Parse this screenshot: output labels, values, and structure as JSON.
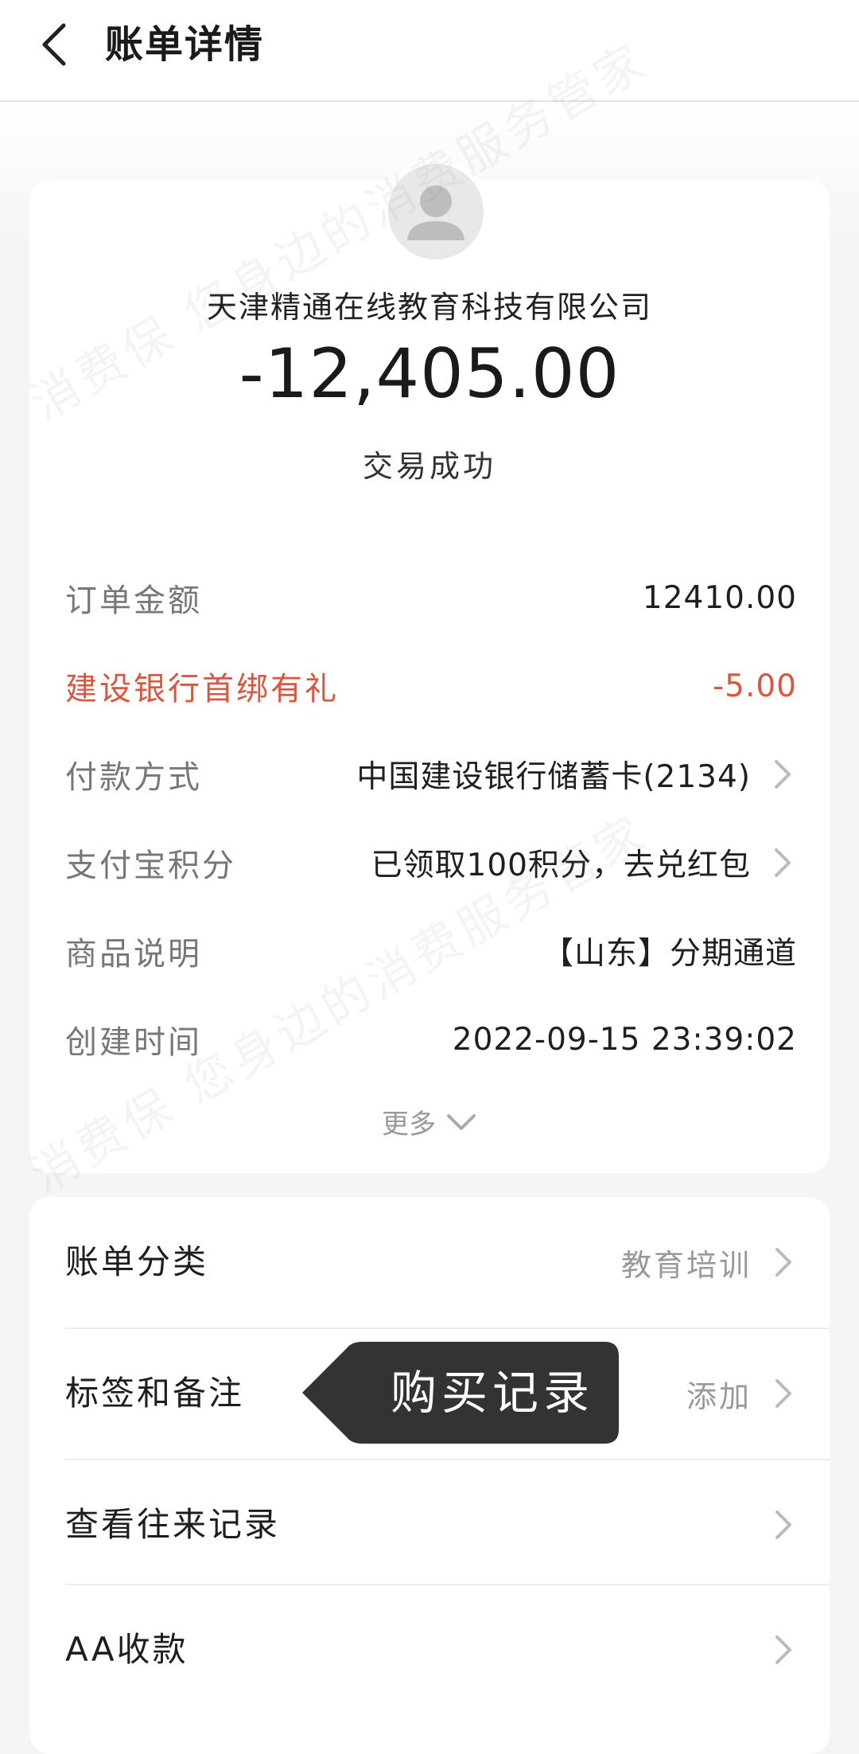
{
  "header": {
    "title": "账单详情",
    "back_icon": "chevron-left-icon"
  },
  "summary": {
    "merchant": "天津精通在线教育科技有限公司",
    "amount": "-12,405.00",
    "status": "交易成功",
    "avatar_icon": "user-icon"
  },
  "details": {
    "rows": [
      {
        "label": "订单金额",
        "value": "12410.00"
      },
      {
        "label": "建设银行首绑有礼",
        "value": "-5.00",
        "highlight_color": "#d9573f"
      },
      {
        "label": "付款方式",
        "value": "中国建设银行储蓄卡(2134)"
      },
      {
        "label": "支付宝积分",
        "value": "已领取100积分，去兑红包"
      },
      {
        "label": "商品说明",
        "value": "【山东】分期通道"
      },
      {
        "label": "创建时间",
        "value": "2022-09-15 23:39:02"
      }
    ],
    "more_label": "更多"
  },
  "actions": {
    "rows": [
      {
        "label": "账单分类",
        "value": "教育培训"
      },
      {
        "label": "标签和备注",
        "value": "添加"
      },
      {
        "label": "查看往来记录",
        "value": ""
      },
      {
        "label": "AA收款",
        "value": ""
      }
    ]
  },
  "tooltip": {
    "text": "购买记录"
  },
  "watermark": {
    "line1": "消费保 您身边的消费服务管家",
    "line2": "消费保 您身边的消费服务管家"
  },
  "colors": {
    "accent_red": "#d9573f",
    "tooltip_bg": "#333333"
  }
}
